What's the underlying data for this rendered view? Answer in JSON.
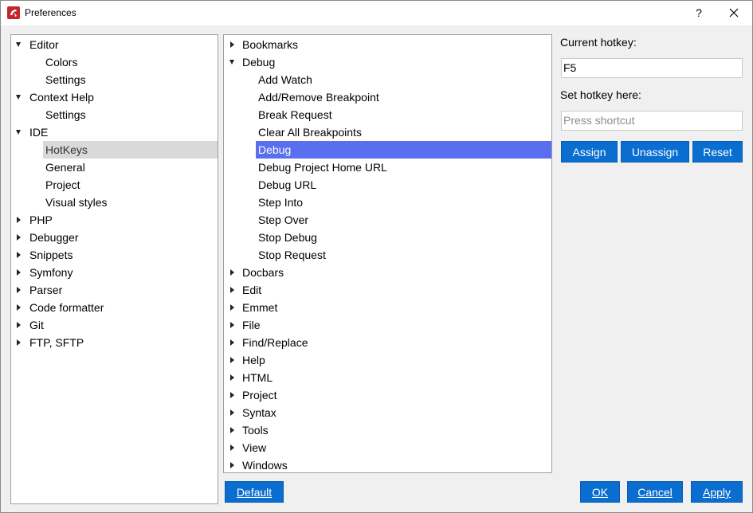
{
  "window": {
    "title": "Preferences",
    "help_label": "?"
  },
  "left_tree": [
    {
      "label": "Editor",
      "expanded": true,
      "level": 0
    },
    {
      "label": "Colors",
      "level": 1
    },
    {
      "label": "Settings",
      "level": 1
    },
    {
      "label": "Context Help",
      "expanded": true,
      "level": 0
    },
    {
      "label": "Settings",
      "level": 1
    },
    {
      "label": "IDE",
      "expanded": true,
      "level": 0
    },
    {
      "label": "HotKeys",
      "level": 1,
      "selected": true
    },
    {
      "label": "General",
      "level": 1
    },
    {
      "label": "Project",
      "level": 1
    },
    {
      "label": "Visual styles",
      "level": 1
    },
    {
      "label": "PHP",
      "expanded": false,
      "level": 0
    },
    {
      "label": "Debugger",
      "expanded": false,
      "level": 0
    },
    {
      "label": "Snippets",
      "expanded": false,
      "level": 0
    },
    {
      "label": "Symfony",
      "expanded": false,
      "level": 0
    },
    {
      "label": "Parser",
      "expanded": false,
      "level": 0
    },
    {
      "label": "Code formatter",
      "expanded": false,
      "level": 0
    },
    {
      "label": "Git",
      "expanded": false,
      "level": 0
    },
    {
      "label": "FTP, SFTP",
      "expanded": false,
      "level": 0
    }
  ],
  "hotkey_tree": [
    {
      "label": "Bookmarks",
      "expanded": false,
      "level": 0
    },
    {
      "label": "Debug",
      "expanded": true,
      "level": 0
    },
    {
      "label": "Add Watch",
      "level": 1
    },
    {
      "label": "Add/Remove Breakpoint",
      "level": 1
    },
    {
      "label": "Break Request",
      "level": 1
    },
    {
      "label": "Clear All Breakpoints",
      "level": 1
    },
    {
      "label": "Debug",
      "level": 1,
      "selected": true
    },
    {
      "label": "Debug Project Home URL",
      "level": 1
    },
    {
      "label": "Debug URL",
      "level": 1
    },
    {
      "label": "Step Into",
      "level": 1
    },
    {
      "label": "Step Over",
      "level": 1
    },
    {
      "label": "Stop Debug",
      "level": 1
    },
    {
      "label": "Stop Request",
      "level": 1
    },
    {
      "label": "Docbars",
      "expanded": false,
      "level": 0
    },
    {
      "label": "Edit",
      "expanded": false,
      "level": 0
    },
    {
      "label": "Emmet",
      "expanded": false,
      "level": 0
    },
    {
      "label": "File",
      "expanded": false,
      "level": 0
    },
    {
      "label": "Find/Replace",
      "expanded": false,
      "level": 0
    },
    {
      "label": "Help",
      "expanded": false,
      "level": 0
    },
    {
      "label": "HTML",
      "expanded": false,
      "level": 0
    },
    {
      "label": "Project",
      "expanded": false,
      "level": 0
    },
    {
      "label": "Syntax",
      "expanded": false,
      "level": 0
    },
    {
      "label": "Tools",
      "expanded": false,
      "level": 0
    },
    {
      "label": "View",
      "expanded": false,
      "level": 0
    },
    {
      "label": "Windows",
      "expanded": false,
      "level": 0
    }
  ],
  "hotkey_panel": {
    "current_label": "Current hotkey:",
    "current_value": "F5",
    "set_label": "Set hotkey here:",
    "set_placeholder": "Press shortcut",
    "assign": "Assign",
    "unassign": "Unassign",
    "reset": "Reset"
  },
  "footer": {
    "default": "Default",
    "ok": "OK",
    "cancel": "Cancel",
    "apply": "Apply"
  },
  "colors": {
    "selection_blue": "#5a6ef0",
    "selection_gray": "#d9d9d9",
    "button_blue": "#0a6ed1"
  }
}
